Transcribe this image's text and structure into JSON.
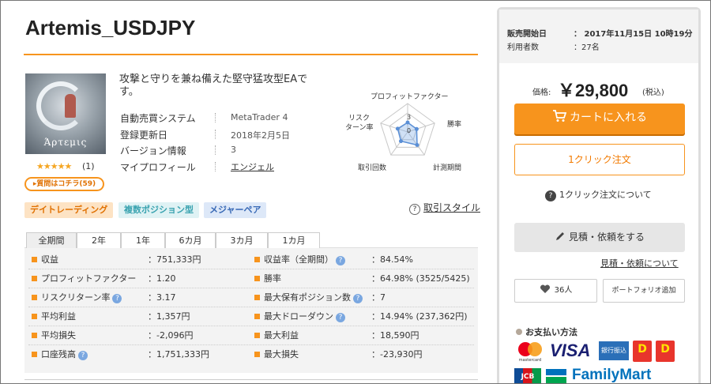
{
  "product": {
    "title": "Artemis_USDJPY",
    "catch_copy": "攻撃と守りを兼ね備えた堅守猛攻型EAです。",
    "thumb_logo": "Άρτεμις",
    "rating_stars": "★★★★★",
    "rating_count": "(1)",
    "qa_button": "▸質問はコチラ(59)"
  },
  "specs": [
    {
      "label": "自動売買システム",
      "value": "MetaTrader 4"
    },
    {
      "label": "登録更新日",
      "value": "2018年2月5日"
    },
    {
      "label": "バージョン情報",
      "value": "3"
    },
    {
      "label": "マイプロフィール",
      "value": "エンジェル"
    }
  ],
  "radar": {
    "labels": {
      "top": "プロフィットファクター",
      "right": "勝率",
      "bottom_right": "計測期間",
      "bottom_left": "取引回数",
      "left_line1": "リスク",
      "left_line2": "ターン率"
    },
    "scale_max": "3",
    "scale_zero": "0",
    "values": {
      "profit_factor": 1,
      "win_rate": 1,
      "period": 1.7,
      "trades": 1.2,
      "risk_return": 1.1
    }
  },
  "tags": [
    "デイトレーディング",
    "複数ポジション型",
    "メジャーペア"
  ],
  "style_link": "取引スタイル",
  "style_link_icon": "?",
  "tabs": [
    "全期間",
    "2年",
    "1年",
    "6カ月",
    "3カ月",
    "1カ月"
  ],
  "stats_left": [
    {
      "label": "収益",
      "value": "：751,333円",
      "help": false
    },
    {
      "label": "プロフィットファクター",
      "value": "：1.20",
      "help": false
    },
    {
      "label": "リスクリターン率",
      "value": "：3.17",
      "help": true
    },
    {
      "label": "平均利益",
      "value": "：1,357円",
      "help": false
    },
    {
      "label": "平均損失",
      "value": "：-2,096円",
      "help": false
    },
    {
      "label": "口座残高",
      "value": "：1,751,333円",
      "help": true
    }
  ],
  "stats_right": [
    {
      "label": "収益率（全期間）",
      "value": "：84.54%",
      "help": true
    },
    {
      "label": "勝率",
      "value": "：64.98% (3525/5425)",
      "help": false
    },
    {
      "label": "最大保有ポジション数",
      "value": "：7",
      "help": true
    },
    {
      "label": "最大ドローダウン",
      "value": "：14.94% (237,362円)",
      "help": true
    },
    {
      "label": "最大利益",
      "value": "：18,590円",
      "help": false
    },
    {
      "label": "最大損失",
      "value": "：-23,930円",
      "help": false
    }
  ],
  "help_icon_text": "?",
  "sidebar": {
    "sale_start_label": "販売開始日",
    "sale_start_value": "：  2017年11月15日 10時19分",
    "users_label": "利用者数",
    "users_value": "：27名",
    "price_label": "価格:",
    "price": "￥29,800",
    "price_tax": "(税込)",
    "cart_button": "カートに入れる",
    "oneclick_button": "1クリック注文",
    "oneclick_about": "1クリック注文について",
    "quote_button": "見積・依頼をする",
    "quote_link": "見積・依頼について",
    "favorite_count": "36人",
    "portfolio_button": "ポートフォリオ追加",
    "payment_title": "お支払い方法",
    "payments": {
      "mastercard": "mastercard",
      "visa": "VISA",
      "bank": "銀行振込",
      "dy": "D",
      "jcb": "JCB",
      "familymart": "FamilyMart"
    }
  },
  "colors": {
    "accent": "#f7941d",
    "link": "#333333",
    "help": "#7aa7e0"
  }
}
